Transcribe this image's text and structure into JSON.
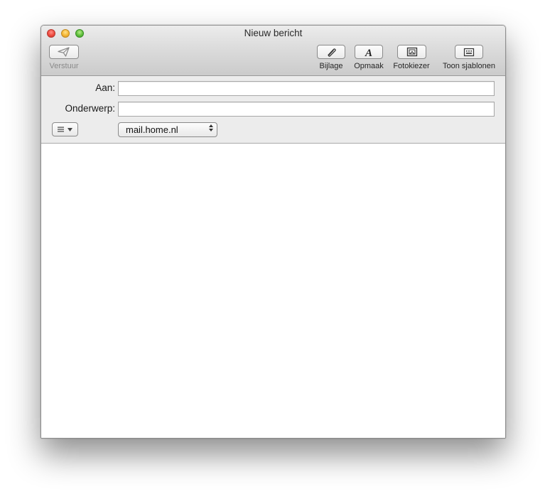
{
  "window": {
    "title": "Nieuw bericht"
  },
  "toolbar": {
    "send_label": "Verstuur",
    "attach_label": "Bijlage",
    "format_label": "Opmaak",
    "photo_browser_label": "Fotokiezer",
    "templates_label": "Toon sjablonen"
  },
  "header": {
    "to_label": "Aan:",
    "to_value": "",
    "subject_label": "Onderwerp:",
    "subject_value": "",
    "from_account": "mail.home.nl"
  },
  "icons": {
    "send": "paper-plane-icon",
    "attach": "paperclip-icon",
    "format": "letter-a-icon",
    "photo": "photo-frame-icon",
    "templates": "template-grid-icon",
    "header_fields": "list-lines-icon"
  },
  "colors": {
    "close": "#ee4a3f",
    "minimize": "#f5b634",
    "zoom": "#5fbf3c"
  }
}
